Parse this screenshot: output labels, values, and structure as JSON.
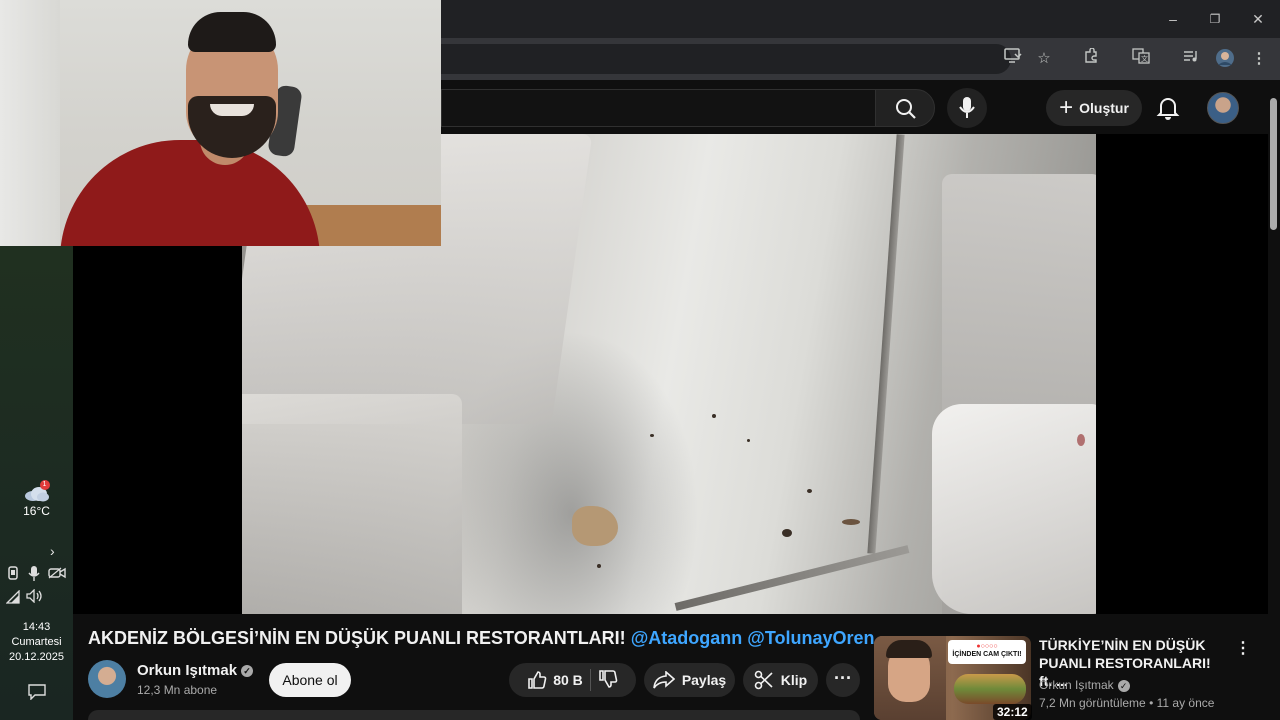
{
  "taskbar": {
    "weather": {
      "temp": "16°C",
      "badge": "1"
    },
    "clock": {
      "time": "14:43",
      "day": "Cumartesi",
      "date": "20.12.2025"
    }
  },
  "browser": {
    "window_controls": {
      "minimize": "–",
      "restore": "❐",
      "close": "✕"
    }
  },
  "youtube": {
    "masthead": {
      "create_label": "Oluştur"
    },
    "video": {
      "title_main": "AKDENİZ BÖLGESİ’NİN EN DÜŞÜK PUANLI RESTORANTLARI!",
      "mention_1": "@Atadogann",
      "mention_2": "@TolunayOren",
      "channel_name": "Orkun Işıtmak",
      "subscribers": "12,3 Mn abone",
      "subscribe_label": "Abone ol",
      "likes": "80 B",
      "share_label": "Paylaş",
      "clip_label": "Klip"
    },
    "suggested": {
      "title": "TÜRKİYE’NİN EN DÜŞÜK PUANLI RESTORANLARI! ft. ...",
      "channel": "Orkun Işıtmak",
      "meta": "7,2 Mn görüntüleme • 11 ay önce",
      "duration": "32:12",
      "thumb_caption": "İÇİNDEN CAM ÇIKTI!"
    }
  },
  "colors": {
    "mention": "#3ea6ff",
    "background": "#0f0f0f",
    "pill": "#272727"
  }
}
